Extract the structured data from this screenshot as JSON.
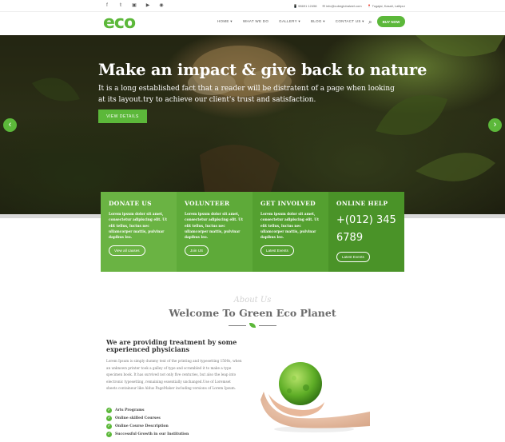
{
  "topbar": {
    "social_icons": [
      "facebook-icon",
      "twitter-icon",
      "linkedin-icon",
      "youtube-icon",
      "pinterest-icon"
    ],
    "phone": "98691 12458",
    "email": "info@cubeglobalwel.com",
    "address": "Tugajai, Kasali, Lalitpur"
  },
  "header": {
    "logo": "eco",
    "nav": [
      "HOME ▾",
      "WHAT WE DO",
      "GALLERY ▾",
      "BLOG ▾",
      "CONTACT US ▾"
    ],
    "buy_label": "BUY NOW"
  },
  "hero": {
    "title": "Make an impact & give back to nature",
    "subtitle": "It is a long established fact that a reader will be distratent of a page when looking at its layout.try to achieve our client's trust and satisfaction.",
    "button": "VIEW DETAILS"
  },
  "cards": [
    {
      "title": "DONATE US",
      "text": "Lorem ipsum dolor sit amet, consectetur adipiscing elit. Ut elit tellus, luctus nec ullamcorper mattis, pulvinar dapibus leo.",
      "button": "View all causes"
    },
    {
      "title": "VOLUNTEER",
      "text": "Lorem ipsum dolor sit amet, consectetur adipiscing elit. Ut elit tellus, luctus nec ullamcorper mattis, pulvinar dapibus leo.",
      "button": "Join US"
    },
    {
      "title": "GET INVOLVED",
      "text": "Lorem ipsum dolor sit amet, consectetur adipiscing elit. Ut elit tellus, luctus nec ullamcorper mattis, pulvinar dapibus leo.",
      "button": "Latest Events"
    },
    {
      "title": "ONLINE HELP",
      "phone": "+(012) 345 6789",
      "button": "Latest Events"
    }
  ],
  "about": {
    "script": "About Us",
    "title": "Welcome To Green Eco Planet",
    "subhead": "We are providing treatment by some experienced physicians",
    "paragraph": "Lorem Ipsum is simply dummy text of the printing and typesetting 1500s, when an unknown printer took a galley of type and scrambled it to make a type specimen book. It has survived not only five centuries, but also the leap into electronic typesetting, remaining essentially unchanged.Use of Loremset sheets containeur like Aldus PageMaker including versions of Lorem Ipsum.",
    "features": [
      "Arts Programs",
      "Online skilled Courses",
      "Online Course Description",
      "Successful Growth in our Institution"
    ]
  },
  "colors": {
    "accent": "#5cb83a",
    "card1": "#6ab343",
    "card4": "#4a9328"
  }
}
